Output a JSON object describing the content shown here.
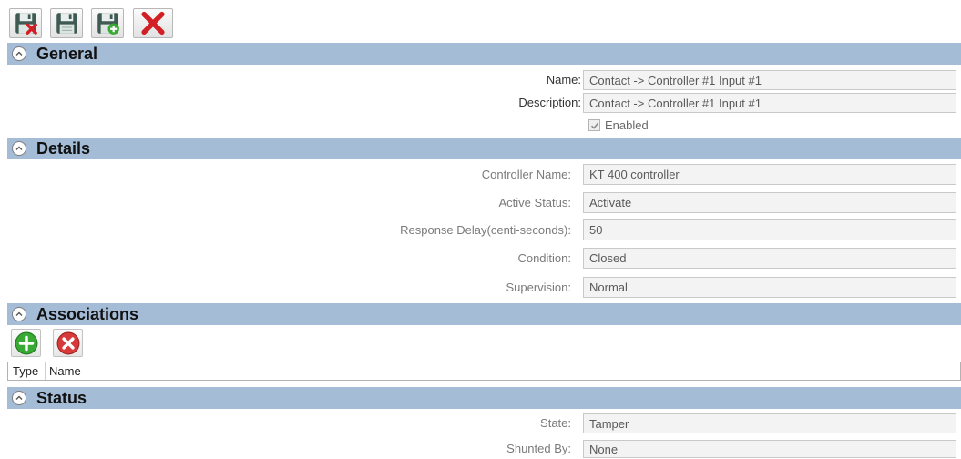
{
  "colors": {
    "section_bar": "#a5bcd7",
    "add": "#38a934",
    "remove": "#d83a3a",
    "close": "#d21f26"
  },
  "toolbar": {
    "buttons": [
      {
        "icon": "save-close-icon"
      },
      {
        "icon": "save-icon"
      },
      {
        "icon": "save-new-icon"
      },
      {
        "icon": "close-icon"
      }
    ]
  },
  "general": {
    "title": "General",
    "fields": [
      {
        "label": "Name:",
        "value": "Contact -> Controller #1 Input #1"
      },
      {
        "label": "Description:",
        "value": "Contact -> Controller #1 Input #1"
      }
    ],
    "enabled": {
      "label": "Enabled",
      "checked": true
    }
  },
  "details": {
    "title": "Details",
    "fields": [
      {
        "label": "Controller Name:",
        "value": "KT 400 controller"
      },
      {
        "label": "Active Status:",
        "value": "Activate"
      },
      {
        "label": "Response Delay(centi-seconds):",
        "value": "50"
      },
      {
        "label": "Condition:",
        "value": "Closed"
      },
      {
        "label": "Supervision:",
        "value": "Normal"
      }
    ]
  },
  "associations": {
    "title": "Associations",
    "buttons": [
      {
        "icon": "add-icon"
      },
      {
        "icon": "remove-icon"
      }
    ],
    "columns": [
      "Type",
      "Name"
    ],
    "rows": []
  },
  "status": {
    "title": "Status",
    "fields": [
      {
        "label": "State:",
        "value": "Tamper"
      },
      {
        "label": "Shunted By:",
        "value": "None"
      }
    ]
  }
}
